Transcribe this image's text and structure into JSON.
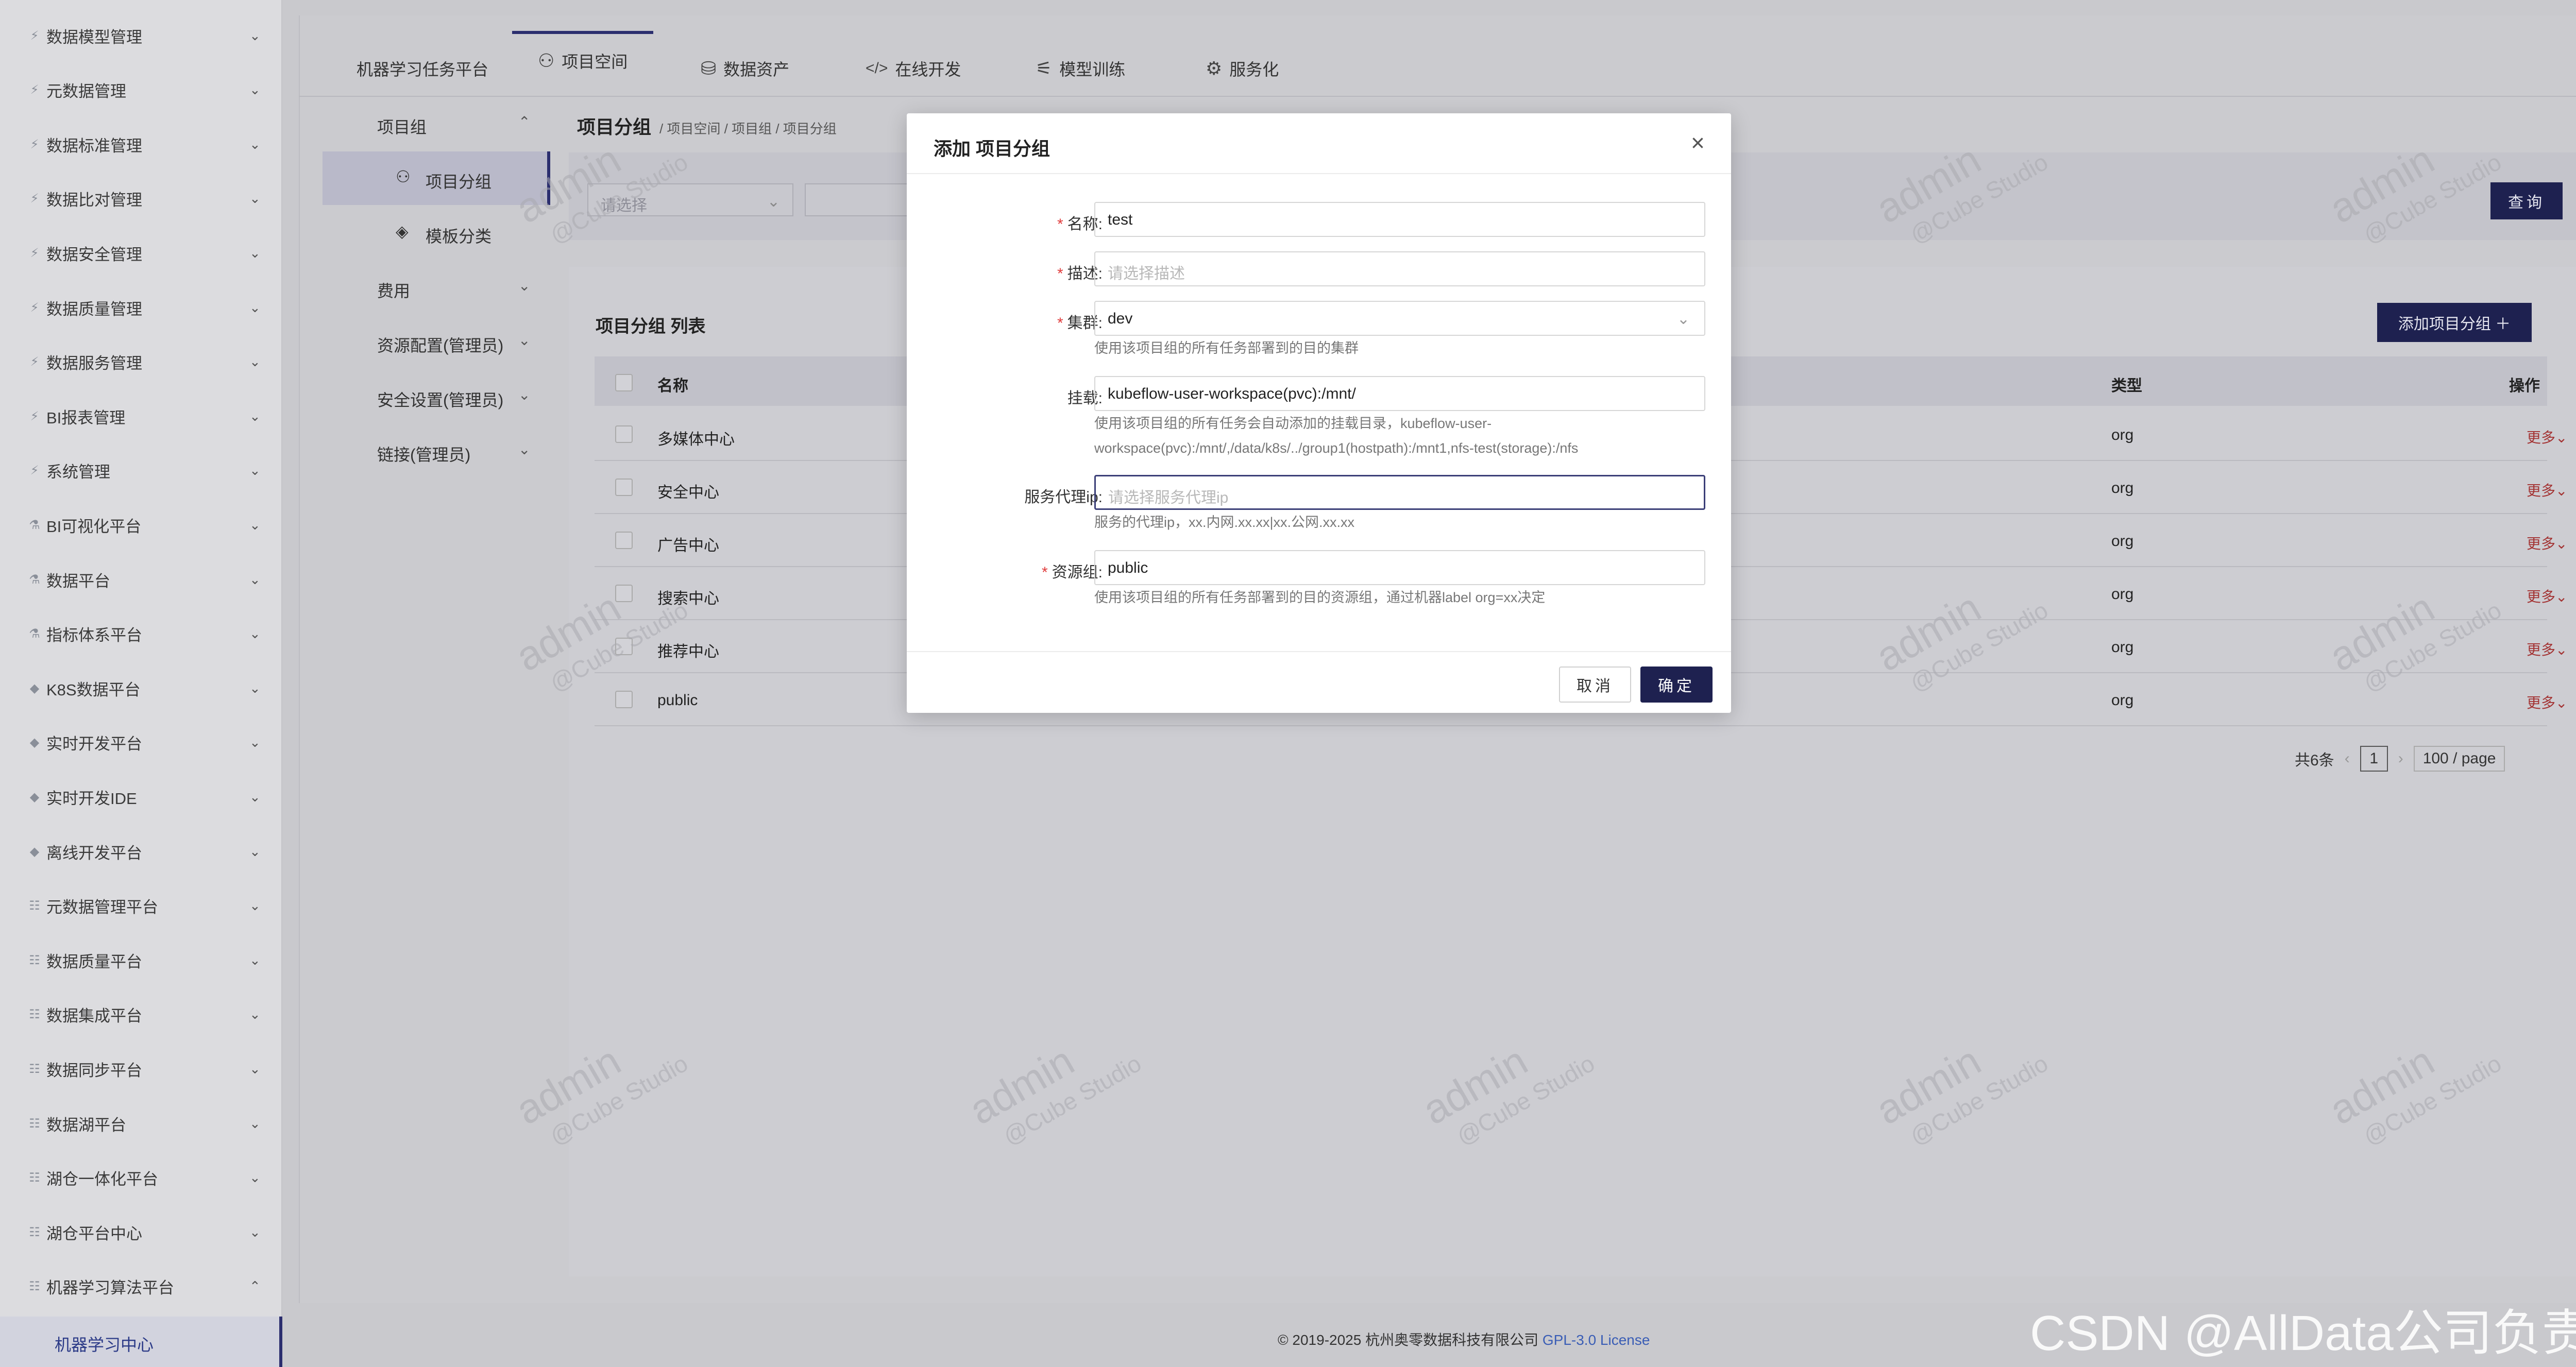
{
  "sidebar": {
    "items": [
      {
        "label": "数据模型管理",
        "icon": "⚡"
      },
      {
        "label": "元数据管理",
        "icon": "⚡"
      },
      {
        "label": "数据标准管理",
        "icon": "⚡"
      },
      {
        "label": "数据比对管理",
        "icon": "⚡"
      },
      {
        "label": "数据安全管理",
        "icon": "⚡"
      },
      {
        "label": "数据质量管理",
        "icon": "⚡"
      },
      {
        "label": "数据服务管理",
        "icon": "⚡"
      },
      {
        "label": "BI报表管理",
        "icon": "⚡"
      },
      {
        "label": "系统管理",
        "icon": "⚡"
      },
      {
        "label": "BI可视化平台",
        "icon": "⚗"
      },
      {
        "label": "数据平台",
        "icon": "⚗"
      },
      {
        "label": "指标体系平台",
        "icon": "⚗"
      },
      {
        "label": "K8S数据平台",
        "icon": "◆"
      },
      {
        "label": "实时开发平台",
        "icon": "◆"
      },
      {
        "label": "实时开发IDE",
        "icon": "◆"
      },
      {
        "label": "离线开发平台",
        "icon": "◆"
      },
      {
        "label": "元数据管理平台",
        "icon": "☷"
      },
      {
        "label": "数据质量平台",
        "icon": "☷"
      },
      {
        "label": "数据集成平台",
        "icon": "☷"
      },
      {
        "label": "数据同步平台",
        "icon": "☷"
      },
      {
        "label": "数据湖平台",
        "icon": "☷"
      },
      {
        "label": "湖仓一体化平台",
        "icon": "☷"
      },
      {
        "label": "湖仓平台中心",
        "icon": "☷"
      },
      {
        "label": "机器学习算法平台",
        "icon": "☷",
        "expanded": true
      }
    ],
    "active_sub": "机器学习中心"
  },
  "topnav": {
    "tabs": [
      {
        "label": "机器学习任务平台",
        "icon": ""
      },
      {
        "label": "项目空间",
        "icon": "⚇"
      },
      {
        "label": "数据资产",
        "icon": "⛁"
      },
      {
        "label": "在线开发",
        "icon": "</>"
      },
      {
        "label": "模型训练",
        "icon": "⚟"
      },
      {
        "label": "服务化",
        "icon": "⚙"
      }
    ]
  },
  "subnav": {
    "group_label": "项目组",
    "items": [
      {
        "label": "项目分组",
        "icon": "⚇"
      },
      {
        "label": "模板分类",
        "icon": "◈"
      }
    ],
    "others": [
      "费用",
      "资源配置(管理员)",
      "安全设置(管理员)",
      "链接(管理员)"
    ]
  },
  "breadcrumb": {
    "title": "项目分组",
    "path": "/ 项目空间 / 项目组 / 项目分组"
  },
  "search": {
    "select_placeholder": "请选择",
    "query_label": "查询"
  },
  "list": {
    "title": "项目分组 列表",
    "add_label": "添加项目分组 ＋",
    "columns": {
      "name": "名称",
      "type": "类型",
      "action": "操作"
    },
    "rows": [
      {
        "name": "多媒体中心",
        "type": "org",
        "action": "更多"
      },
      {
        "name": "安全中心",
        "type": "org",
        "action": "更多"
      },
      {
        "name": "广告中心",
        "type": "org",
        "action": "更多"
      },
      {
        "name": "搜索中心",
        "type": "org",
        "action": "更多"
      },
      {
        "name": "推荐中心",
        "type": "org",
        "action": "更多"
      },
      {
        "name": "public",
        "type": "org",
        "action": "更多"
      }
    ],
    "pager": {
      "total": "共6条",
      "page": "1",
      "size": "100 / page"
    }
  },
  "modal": {
    "title": "添加 项目分组",
    "fields": {
      "name": {
        "label": "名称:",
        "value": "test",
        "required": true
      },
      "desc": {
        "label": "描述:",
        "placeholder": "请选择描述",
        "required": true
      },
      "cluster": {
        "label": "集群:",
        "value": "dev",
        "required": true,
        "help": "使用该项目组的所有任务部署到的目的集群"
      },
      "mount": {
        "label": "挂载:",
        "value": "kubeflow-user-workspace(pvc):/mnt/",
        "help1": "使用该项目组的所有任务会自动添加的挂载目录，kubeflow-user-",
        "help2": "workspace(pvc):/mnt/,/data/k8s/../group1(hostpath):/mnt1,nfs-test(storage):/nfs"
      },
      "proxy": {
        "label": "服务代理ip:",
        "placeholder": "请选择服务代理ip",
        "help": "服务的代理ip，xx.内网.xx.xx|xx.公网.xx.xx"
      },
      "resource": {
        "label": "资源组:",
        "value": "public",
        "required": true,
        "help": "使用该项目组的所有任务部署到的目的资源组，通过机器label org=xx决定"
      }
    },
    "cancel_label": "取消",
    "ok_label": "确定"
  },
  "footer": {
    "copyright": "© 2019-2025 杭州奥零数据科技有限公司",
    "license": "GPL-3.0 License"
  },
  "watermark": {
    "main": "admin",
    "sub": "@Cube Studio"
  },
  "csdn": "CSDN @AllData公司负责人",
  "colors": {
    "primary": "#1e2150",
    "danger": "#a33333",
    "link": "#3a5db5"
  }
}
